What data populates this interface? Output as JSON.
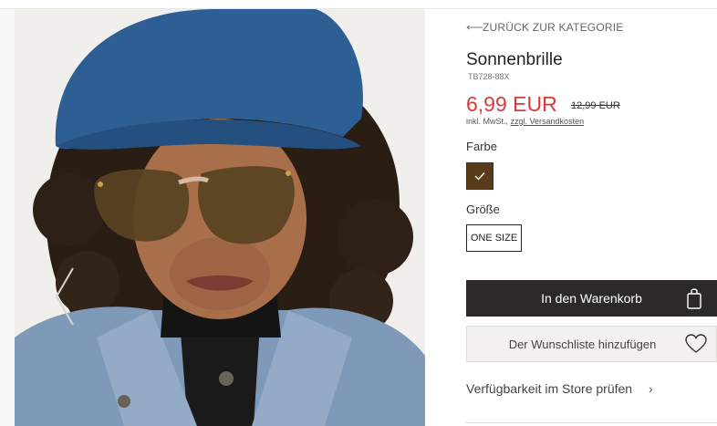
{
  "breadcrumb": {
    "back_label": "ZURÜCK ZUR KATEGORIE",
    "back_arrow_icon": "arrow-left-icon"
  },
  "product": {
    "title": "Sonnenbrille",
    "sku": "TB728-88X",
    "price": "6,99 EUR",
    "old_price": "12,99 EUR",
    "tax_prefix": "inkl. MwSt.,",
    "shipping_link": "zzgl. Versandkosten"
  },
  "color": {
    "label": "Farbe",
    "selected_color": "#5a3b17",
    "check_icon": "check-icon"
  },
  "size": {
    "label": "Größe",
    "selected": "ONE SIZE"
  },
  "actions": {
    "cart_label": "In den Warenkorb",
    "cart_icon": "shopping-bag-icon",
    "wishlist_label": "Der Wunschliste hinzufügen",
    "wishlist_icon": "heart-icon",
    "store_label": "Verfügbarkeit im Store prüfen",
    "store_icon": "chevron-right-icon"
  },
  "colors": {
    "price_red": "#d63b3b",
    "button_dark": "#2b2a29",
    "wishlist_bg": "#f3f1ef"
  }
}
